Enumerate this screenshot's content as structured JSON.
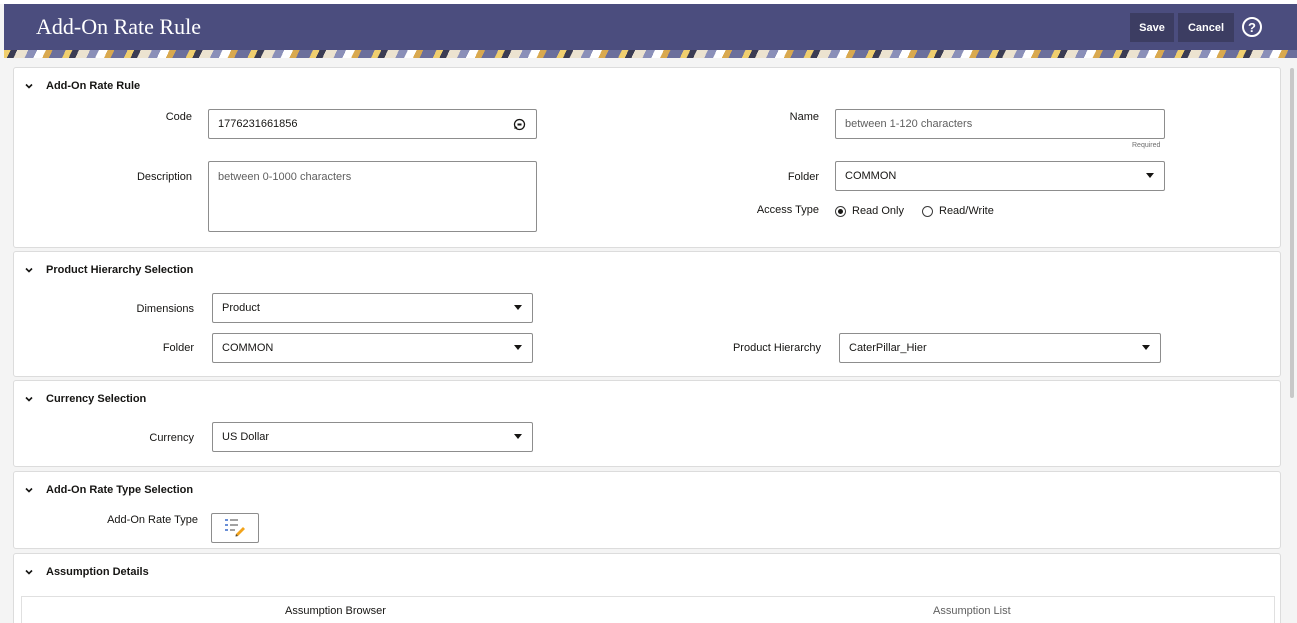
{
  "header": {
    "title": "Add-On Rate Rule",
    "save_label": "Save",
    "cancel_label": "Cancel",
    "help_glyph": "?"
  },
  "rule_section": {
    "title": "Add-On Rate Rule",
    "code_label": "Code",
    "code_value": "1776231661856",
    "name_label": "Name",
    "name_placeholder": "between 1-120 characters",
    "name_required": "Required",
    "description_label": "Description",
    "description_placeholder": "between 0-1000 characters",
    "folder_label": "Folder",
    "folder_value": "COMMON",
    "access_label": "Access Type",
    "access_options": [
      "Read Only",
      "Read/Write"
    ],
    "access_selected": "Read Only"
  },
  "hierarchy_section": {
    "title": "Product Hierarchy Selection",
    "dimensions_label": "Dimensions",
    "dimensions_value": "Product",
    "folder_label": "Folder",
    "folder_value": "COMMON",
    "hierarchy_label": "Product Hierarchy",
    "hierarchy_value": "CaterPillar_Hier"
  },
  "currency_section": {
    "title": "Currency Selection",
    "currency_label": "Currency",
    "currency_value": "US Dollar"
  },
  "ratetype_section": {
    "title": "Add-On Rate Type Selection",
    "ratetype_label": "Add-On Rate Type"
  },
  "assumption_section": {
    "title": "Assumption Details",
    "tabs": [
      "Assumption Browser",
      "Assumption List"
    ]
  },
  "colors": {
    "header_bg": "#4b4d7e",
    "header_button_bg": "#3c3d62",
    "text": "#161513"
  },
  "icons": {
    "collapse": "chevron-down-icon",
    "code_generate": "refresh-icon",
    "help": "help-icon",
    "rate_type": "edit-list-icon"
  }
}
